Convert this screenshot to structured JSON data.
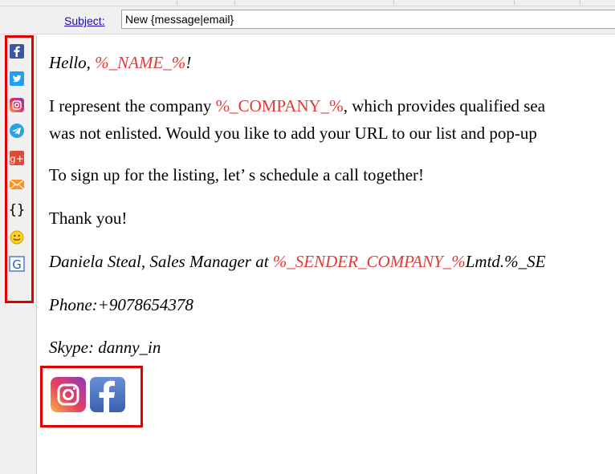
{
  "subject": {
    "label": "Subject:",
    "value": "New {message|email}"
  },
  "toolbar": {
    "items": [
      "facebook-icon",
      "twitter-icon",
      "instagram-icon",
      "telegram-icon",
      "googleplus-icon",
      "mail-icon",
      "braces-icon",
      "smiley-icon",
      "google-icon"
    ],
    "braces_text": "{}",
    "gplus_text": "g+",
    "google_text": "G"
  },
  "body": {
    "greeting_pre": "Hello, ",
    "greeting_var": "%_NAME_%",
    "greeting_post": "!",
    "line1_pre": "I represent the company ",
    "line1_var": "%_COMPANY_%",
    "line1_post": ", which provides qualified sea",
    "line2": "was not enlisted. Would you like to add your URL to our list and pop-up",
    "line3": "To sign up for the listing, let’ s schedule a call together!",
    "line4": "Thank you!",
    "sig_pre": "Daniela Steal, Sales Manager at ",
    "sig_var": "%_SENDER_COMPANY_%",
    "sig_post": "Lmtd.%_SE",
    "phone": "Phone:+9078654378",
    "skype": "Skype: danny_in"
  },
  "colors": {
    "variable": "#e53935",
    "highlight": "#e00000",
    "link": "#1a0dab"
  }
}
